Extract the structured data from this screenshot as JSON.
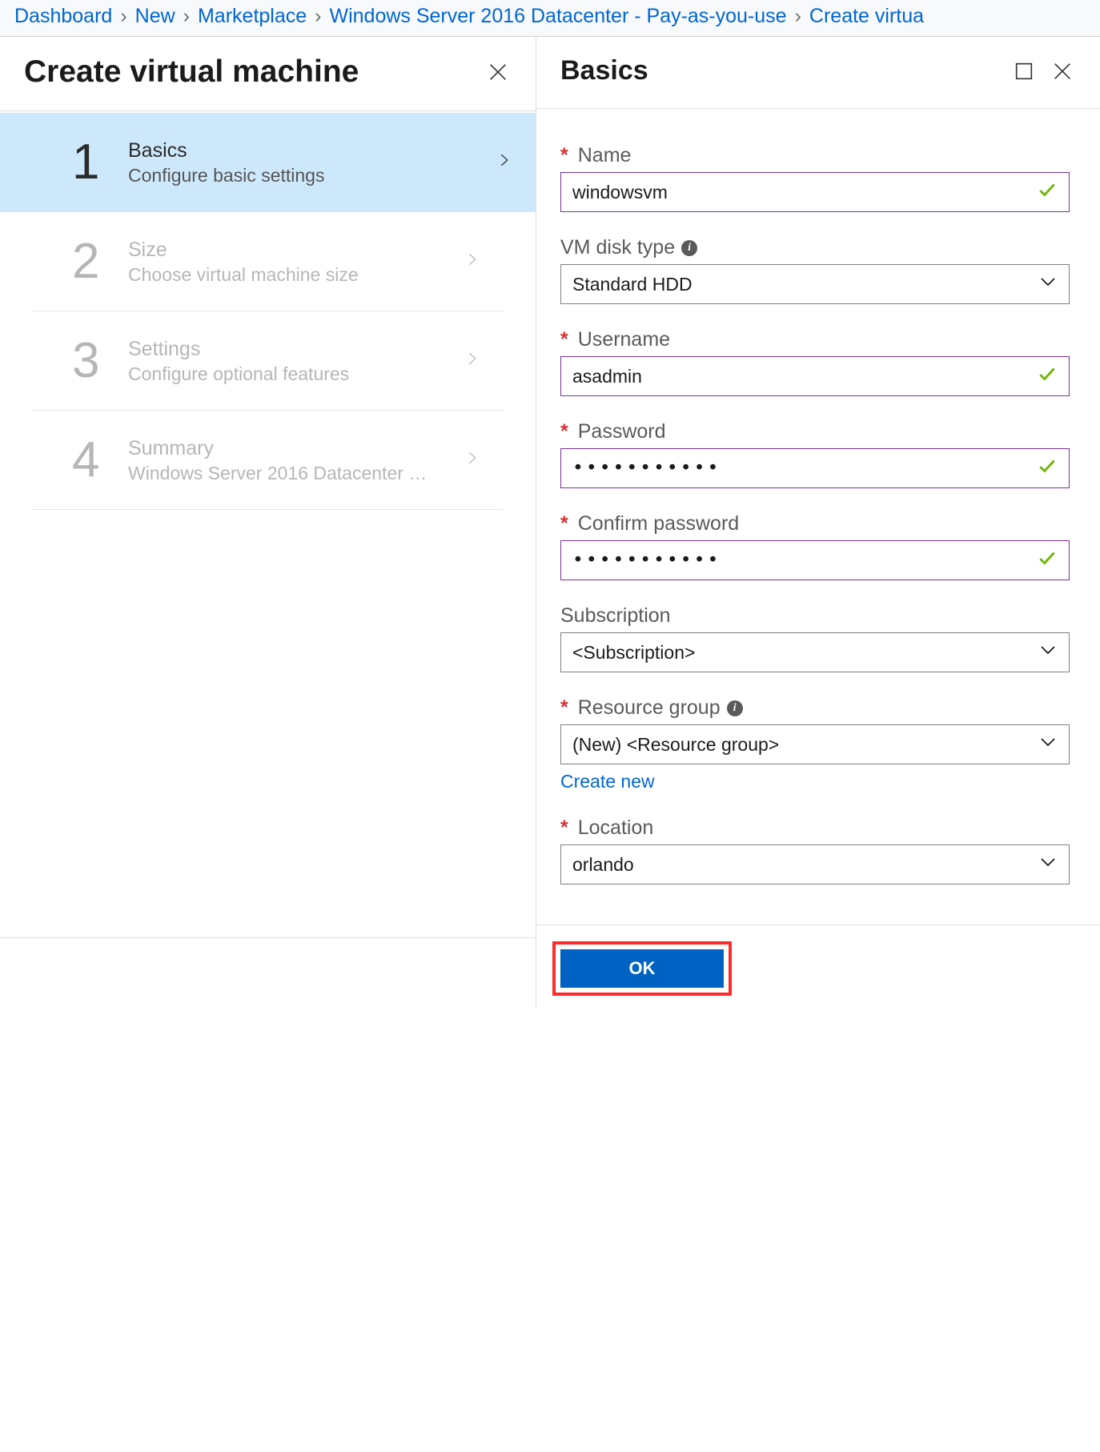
{
  "breadcrumb": {
    "items": [
      "Dashboard",
      "New",
      "Marketplace",
      "Windows Server 2016 Datacenter - Pay-as-you-use",
      "Create virtua"
    ]
  },
  "left": {
    "title": "Create virtual machine",
    "steps": [
      {
        "num": "1",
        "label": "Basics",
        "sub": "Configure basic settings",
        "active": true
      },
      {
        "num": "2",
        "label": "Size",
        "sub": "Choose virtual machine size",
        "active": false
      },
      {
        "num": "3",
        "label": "Settings",
        "sub": "Configure optional features",
        "active": false
      },
      {
        "num": "4",
        "label": "Summary",
        "sub": "Windows Server 2016 Datacenter …",
        "active": false
      }
    ]
  },
  "right": {
    "title": "Basics",
    "fields": {
      "name": {
        "label": "Name",
        "value": "windowsvm",
        "required": true,
        "valid": true
      },
      "disk": {
        "label": "VM disk type",
        "value": "Standard HDD",
        "required": false,
        "info": true
      },
      "username": {
        "label": "Username",
        "value": "asadmin",
        "required": true,
        "valid": true
      },
      "password": {
        "label": "Password",
        "value": "•••••••••••",
        "required": true,
        "valid": true
      },
      "confirm": {
        "label": "Confirm password",
        "value": "•••••••••••",
        "required": true,
        "valid": true
      },
      "subscription": {
        "label": "Subscription",
        "value": "<Subscription>",
        "required": false
      },
      "resource_group": {
        "label": "Resource group",
        "value": "(New)  <Resource group>",
        "required": true,
        "info": true,
        "create_link": "Create new"
      },
      "location": {
        "label": "Location",
        "value": "orlando",
        "required": true
      }
    },
    "ok": "OK"
  }
}
